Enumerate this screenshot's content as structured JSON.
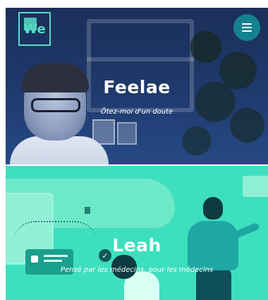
{
  "header": {
    "logo_text": "We",
    "menu_icon": "hamburger-menu-icon"
  },
  "cards": [
    {
      "title": "Feelae",
      "subtitle": "Ôtez-moi d'un doute",
      "overlay_color": "#1f3a6d"
    },
    {
      "title": "Leah",
      "subtitle": "Pensé par les médecins, pour les médecins",
      "overlay_color": "#3ddfbe"
    }
  ],
  "colors": {
    "accent": "#58dcc7",
    "menu_button": "#13838f"
  }
}
